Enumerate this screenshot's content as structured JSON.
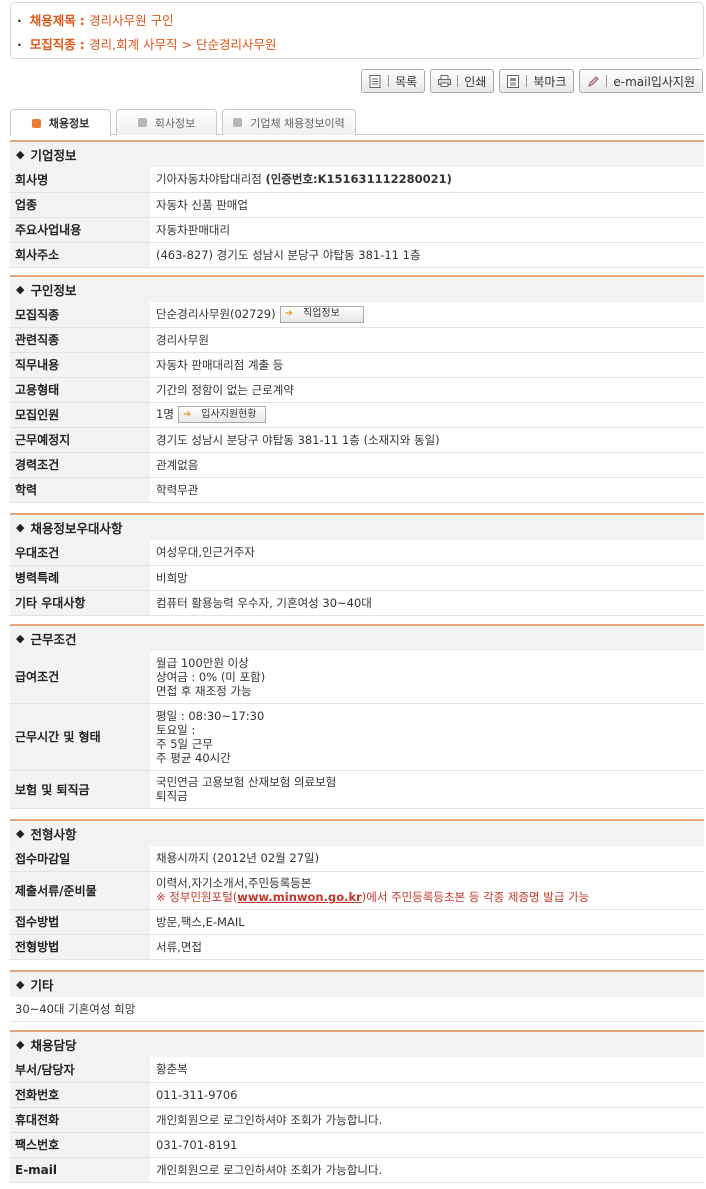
{
  "summary": {
    "title_label": "채용제목",
    "title_value": "경리사무원 구인",
    "job_label": "모집직종",
    "job_value": "경리,회계 사무직 > 단순경리사무원"
  },
  "toolbar": {
    "list": "목록",
    "print": "인쇄",
    "bookmark": "북마크",
    "email_apply": "e-mail입사지원"
  },
  "tabs": [
    {
      "label": "채용정보"
    },
    {
      "label": "회사정보"
    },
    {
      "label": "기업체 채용정보이력"
    }
  ],
  "company": {
    "header": "기업정보",
    "rows": [
      {
        "k": "회사명",
        "v": "기아자동차야탑대리점",
        "v2": "(인증번호:K151631112280021)"
      },
      {
        "k": "업종",
        "v": "자동차 신품 판매업"
      },
      {
        "k": "주요사업내용",
        "v": "자동차판매대리"
      },
      {
        "k": "회사주소",
        "v": "(463-827) 경기도 성남시 분당구 야탑동 381-11 1층"
      }
    ]
  },
  "recruit": {
    "header": "구인정보",
    "rows": [
      {
        "k": "모집직종",
        "v": "단순경리사무원(02729)",
        "btn": "직업정보"
      },
      {
        "k": "관련직종",
        "v": "경리사무원"
      },
      {
        "k": "직무내용",
        "v": "자동차 판매대리점 계출 등"
      },
      {
        "k": "고용형태",
        "v": "기간의 정함이 없는 근로계약"
      },
      {
        "k": "모집인원",
        "v": "1명",
        "btn": "입사지원현황"
      },
      {
        "k": "근무예정지",
        "v": "경기도 성남시 분당구 야탑동 381-11 1층 (소재지와 동일)"
      },
      {
        "k": "경력조건",
        "v": "관계없음"
      },
      {
        "k": "학력",
        "v": "학력무관"
      }
    ]
  },
  "preference": {
    "header": "채용정보우대사항",
    "rows": [
      {
        "k": "우대조건",
        "v": "여성우대,인근거주자"
      },
      {
        "k": "병력특례",
        "v": "비희망"
      },
      {
        "k": "기타 우대사항",
        "v": "컴퓨터 활용능력 우수자, 기혼여성 30~40대"
      }
    ]
  },
  "conditions": {
    "header": "근무조건",
    "pay_label": "급여조건",
    "pay_lines": [
      "월급 100만원 이상",
      "상여금 : 0% (미 포함)",
      "면접 후 재조정 가능"
    ],
    "hours_label": "근무시간 및 형태",
    "hours_lines": [
      "평일 : 08:30~17:30",
      "토요일 :",
      "주 5일 근무",
      "주 평균 40시간"
    ],
    "insurance_label": "보험 및 퇴직금",
    "insurance_lines": [
      "국민연금 고용보험 산재보험 의료보험",
      "퇴직금"
    ]
  },
  "selection": {
    "header": "전형사항",
    "deadline_label": "접수마감일",
    "deadline_value": "채용시까지 (2012년 02월 27일)",
    "docs_label": "제출서류/준비물",
    "docs_value": "이력서,자기소개서,주민등록등본",
    "docs_note_pre": "※ 정부민원포털(",
    "docs_note_link": "www.minwon.go.kr",
    "docs_note_post": ")에서 주민등록등초본 등 각종 제증명 발급 가능",
    "method_label": "접수방법",
    "method_value": "방문,팩스,E-MAIL",
    "screen_label": "전형방법",
    "screen_value": "서류,면접"
  },
  "etc": {
    "header": "기타",
    "text": "30~40대 기혼여성 희망"
  },
  "contact": {
    "header": "채용담당",
    "rows": [
      {
        "k": "부서/담당자",
        "v": "황춘복"
      },
      {
        "k": "전화번호",
        "v": "011-311-9706"
      },
      {
        "k": "휴대전화",
        "v": "개인회원으로 로그인하셔야 조회가 가능합니다."
      },
      {
        "k": "팩스번호",
        "v": "031-701-8191"
      },
      {
        "k": "E-mail",
        "v": "개인회원으로 로그인하셔야 조회가 가능합니다."
      }
    ]
  }
}
